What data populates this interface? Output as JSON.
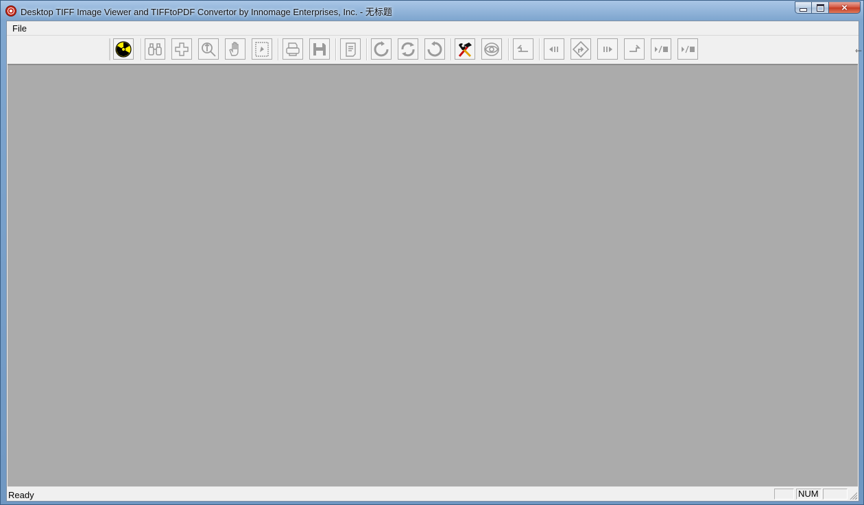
{
  "window": {
    "title": "Desktop TIFF Image Viewer and TIFFtoPDF Convertor by Innomage Enterprises, Inc. - 无标题",
    "app_icon": "app-target-icon",
    "caption_buttons": {
      "minimize": "minimize-icon",
      "maximize": "maximize-icon",
      "close": "×"
    }
  },
  "menu": {
    "items": [
      {
        "label": "File"
      }
    ]
  },
  "toolbar": {
    "buttons": [
      {
        "name": "radiation-button",
        "icon": "radiation-icon",
        "enabled": true
      },
      {
        "name": "find-button",
        "icon": "binoculars-icon",
        "enabled": false
      },
      {
        "name": "zoom-in-button",
        "icon": "plus-icon",
        "enabled": false
      },
      {
        "name": "zoom-button",
        "icon": "magnifier-icon",
        "enabled": false
      },
      {
        "name": "pan-button",
        "icon": "hand-icon",
        "enabled": false
      },
      {
        "name": "stamp-button",
        "icon": "stamp-icon",
        "enabled": false
      },
      {
        "name": "print-button",
        "icon": "printer-icon",
        "enabled": false
      },
      {
        "name": "save-button",
        "icon": "floppy-icon",
        "enabled": false
      },
      {
        "name": "notes-button",
        "icon": "document-icon",
        "enabled": false
      },
      {
        "name": "rotate-left-button",
        "icon": "rotate-left-icon",
        "enabled": false
      },
      {
        "name": "rotate-both-button",
        "icon": "rotate-both-icon",
        "enabled": false
      },
      {
        "name": "rotate-right-button",
        "icon": "rotate-right-icon",
        "enabled": false
      },
      {
        "name": "tools-button",
        "icon": "hammer-wrench-icon",
        "enabled": true
      },
      {
        "name": "view-button",
        "icon": "eye-icon",
        "enabled": false
      },
      {
        "name": "back-button",
        "icon": "turn-left-icon",
        "enabled": false
      },
      {
        "name": "previous-page-button",
        "icon": "previous-icon",
        "enabled": false
      },
      {
        "name": "goto-button",
        "icon": "route-diamond-icon",
        "enabled": false
      },
      {
        "name": "next-page-button",
        "icon": "next-icon",
        "enabled": false
      },
      {
        "name": "forward-button",
        "icon": "turn-right-icon",
        "enabled": false
      },
      {
        "name": "play-stop-button",
        "icon": "play-stop-icon",
        "enabled": false
      },
      {
        "name": "play-stop-2-button",
        "icon": "play-stop-icon",
        "enabled": false
      }
    ]
  },
  "status": {
    "text": "Ready",
    "num": "NUM"
  }
}
